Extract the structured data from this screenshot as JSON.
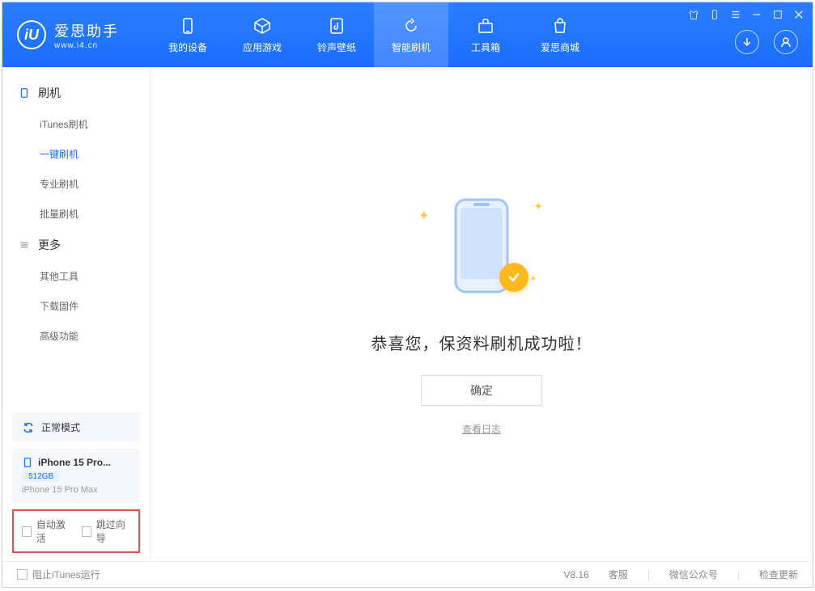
{
  "logo": {
    "title": "爱思助手",
    "subtitle": "www.i4.cn",
    "icon_text": "iU"
  },
  "nav": [
    {
      "label": "我的设备",
      "icon": "device"
    },
    {
      "label": "应用游戏",
      "icon": "apps"
    },
    {
      "label": "铃声壁纸",
      "icon": "ringtone"
    },
    {
      "label": "智能刷机",
      "icon": "flash",
      "active": true
    },
    {
      "label": "工具箱",
      "icon": "toolbox"
    },
    {
      "label": "爱思商城",
      "icon": "store"
    }
  ],
  "sidebar": {
    "groups": [
      {
        "label": "刷机",
        "items": [
          {
            "label": "iTunes刷机"
          },
          {
            "label": "一键刷机",
            "active": true
          },
          {
            "label": "专业刷机"
          },
          {
            "label": "批量刷机"
          }
        ]
      },
      {
        "label": "更多",
        "items": [
          {
            "label": "其他工具"
          },
          {
            "label": "下载固件"
          },
          {
            "label": "高级功能"
          }
        ]
      }
    ],
    "mode_label": "正常模式",
    "device": {
      "name": "iPhone 15 Pro...",
      "storage": "512GB",
      "model": "iPhone 15 Pro Max"
    },
    "checks": [
      {
        "label": "自动激活"
      },
      {
        "label": "跳过向导"
      }
    ]
  },
  "main": {
    "success_text": "恭喜您，保资料刷机成功啦！",
    "ok_button": "确定",
    "log_link": "查看日志"
  },
  "footer": {
    "block_itunes": "阻止iTunes运行",
    "version": "V8.16",
    "links": [
      "客服",
      "微信公众号",
      "检查更新"
    ]
  }
}
